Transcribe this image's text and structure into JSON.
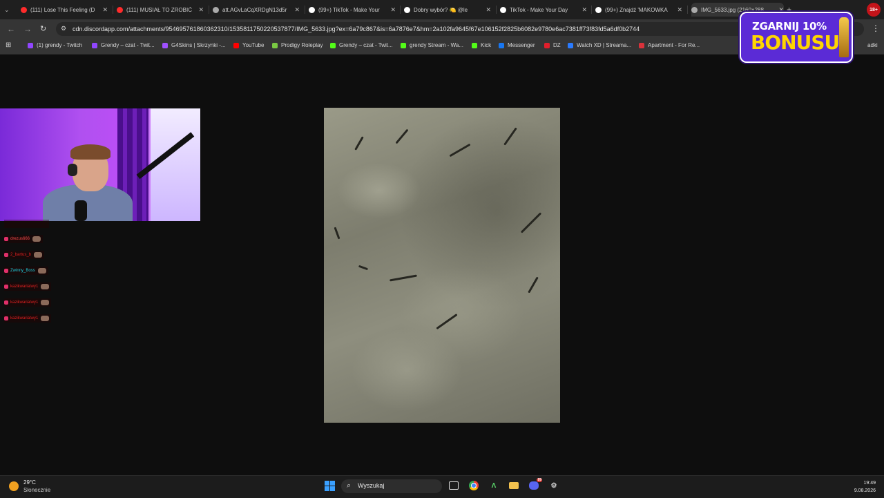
{
  "browser": {
    "tabs": [
      {
        "title": "(111) Lose This Feeling (D",
        "favicon": "youtube-icon",
        "color": "#ff2b2b"
      },
      {
        "title": "(111) MUSIAŁ TO ZROBIĆ",
        "favicon": "youtube-icon",
        "color": "#ff2b2b"
      },
      {
        "title": "att.AGvLaCqXRDgN13d5r",
        "favicon": "globe-icon",
        "color": "#aaaaaa"
      },
      {
        "title": "(99+) TikTok - Make Your",
        "favicon": "tiktok-icon",
        "color": "#ffffff"
      },
      {
        "title": "Dobry wybór? 🍋 @le",
        "favicon": "tiktok-icon",
        "color": "#ffffff"
      },
      {
        "title": "TikTok - Make Your Day",
        "favicon": "tiktok-icon",
        "color": "#ffffff"
      },
      {
        "title": "(99+) Znajdź 'MAKOWKA",
        "favicon": "tiktok-icon",
        "color": "#ffffff"
      },
      {
        "title": "IMG_5633.jpg (2160×288",
        "favicon": "globe-icon",
        "color": "#aaaaaa",
        "active": true
      }
    ],
    "new_tab": "+",
    "url": "cdn.discordapp.com/attachments/954695761860362310/1535811750220537877/IMG_5633.jpg?ex=6a79c867&is=6a7876e7&hm=2a102fa9645f67e106152f2825b6082e9780e6ac7381ff73f83fd5a6df0b2744",
    "bookmarks": [
      {
        "label": "(1) grendy - Twitch",
        "color": "#9146ff"
      },
      {
        "label": "Grendy – czat - Twit...",
        "color": "#9146ff"
      },
      {
        "label": "G4Skins | Skrzynki -...",
        "color": "#a050ff"
      },
      {
        "label": "YouTube",
        "color": "#ff0000"
      },
      {
        "label": "Prodigy Roleplay",
        "color": "#7ac943"
      },
      {
        "label": "Grendy – czat - Twit...",
        "color": "#53fc18"
      },
      {
        "label": "grendy Stream - Wa...",
        "color": "#53fc18"
      },
      {
        "label": "Kick",
        "color": "#53fc18"
      },
      {
        "label": "Messenger",
        "color": "#1877f2"
      },
      {
        "label": "DZ",
        "color": "#e01e2b"
      },
      {
        "label": "Watch XD | Streama...",
        "color": "#2a7bff"
      },
      {
        "label": "Apartment - For Re...",
        "color": "#d9323b"
      }
    ],
    "bookmarks_more": "adki"
  },
  "overlay": {
    "promo_line1": "ZGARNIJ 10%",
    "promo_line2": "BONUSU",
    "age_badge": "18+",
    "chat_messages": [
      {
        "user": "drezus666",
        "color": "#ff4b4b"
      },
      {
        "user": "2_bartus_b",
        "color": "#e02020"
      },
      {
        "user": "Zwinny_Boss",
        "color": "#20d0e0"
      },
      {
        "user": "kazikwariatwy1",
        "color": "#e02020"
      },
      {
        "user": "kazikwariatwy1",
        "color": "#e02020"
      },
      {
        "user": "kazikwariatwy1",
        "color": "#e02020"
      }
    ]
  },
  "taskbar": {
    "weather_temp": "29°C",
    "weather_desc": "Słonecznie",
    "search_placeholder": "Wyszukaj",
    "time": "19:49",
    "date": "9.08.2026",
    "discord_badge": "99"
  }
}
